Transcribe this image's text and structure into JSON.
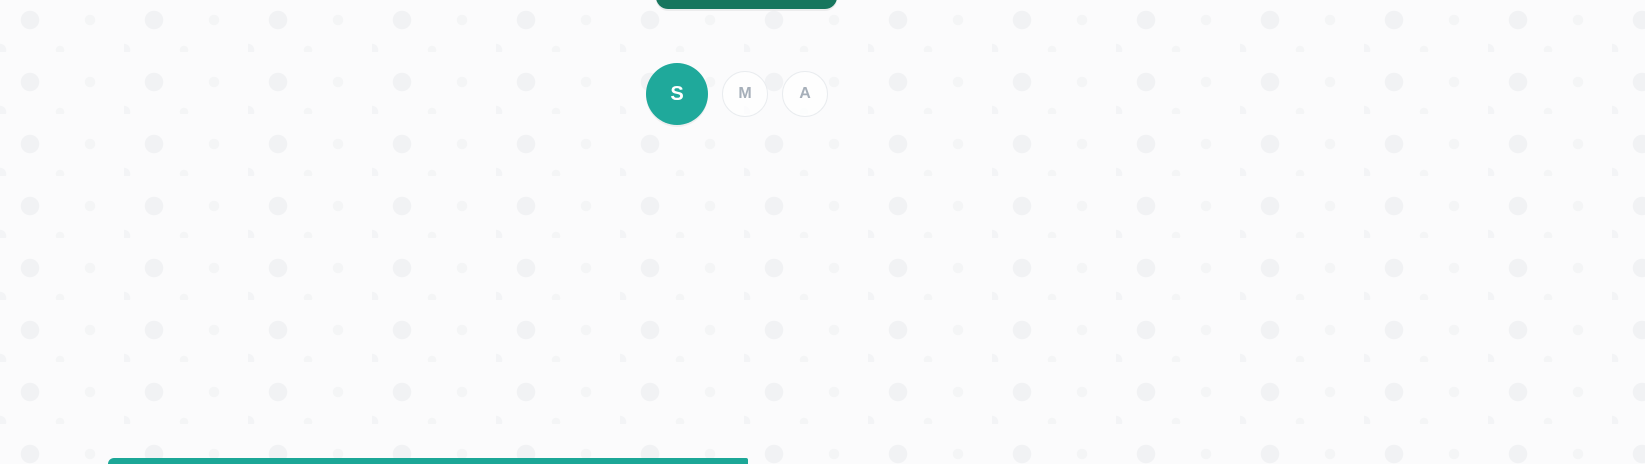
{
  "segmented_control": {
    "items": [
      {
        "label": "S",
        "selected": true
      },
      {
        "label": "M",
        "selected": false
      },
      {
        "label": "A",
        "selected": false
      }
    ]
  },
  "colors": {
    "primary_dark": "#17765e",
    "accent": "#1fa99b",
    "muted_text": "#a6afb9",
    "background": "#fbfbfc"
  }
}
